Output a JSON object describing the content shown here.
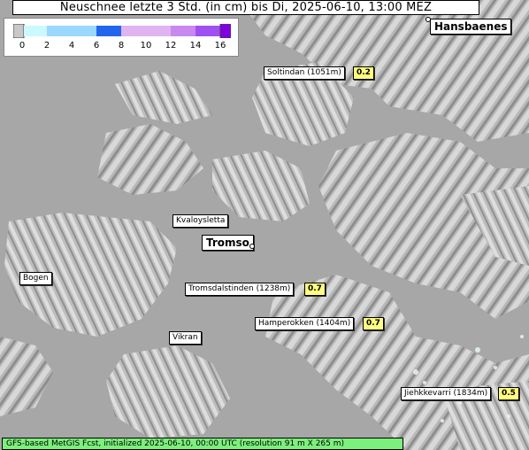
{
  "title": "Neuschnee letzte 3 Std. (in cm) bis Di, 2025-06-10, 13:00 MEZ",
  "legend": {
    "ticks": [
      "0",
      "2",
      "4",
      "6",
      "8",
      "10",
      "12",
      "14",
      "16"
    ],
    "colors": [
      "#c8c8c8",
      "#ccf8ff",
      "#9ad8ff",
      "#62aaff",
      "#2266ee",
      "#e0b4f0",
      "#c888f0",
      "#a050f0",
      "#8000e0"
    ]
  },
  "places": {
    "hansbaenes": "Hansbaenes",
    "soltindan": "Soltindan (1051m)",
    "kvaloysletta": "Kvaloysletta",
    "tromso": "Tromso",
    "bogen": "Bogen",
    "tromsdalstinden": "Tromsdalstinden (1238m)",
    "hamperokken": "Hamperokken (1404m)",
    "vikran": "Vikran",
    "jiehkkevarri": "Jiehkkevarri (1834m)"
  },
  "values": {
    "soltindan": "0.2",
    "tromsdalstinden": "0.7",
    "hamperokken": "0.7",
    "jiehkkevarri": "0.5"
  },
  "colors": {
    "value_box": "#ffff80",
    "footer": "#7cf07c",
    "sea": "#a7a7a7"
  },
  "footer": "GFS-based MetGIS Fcst, initialized 2025-06-10, 00:00 UTC  (resolution 91 m X 265 m)"
}
